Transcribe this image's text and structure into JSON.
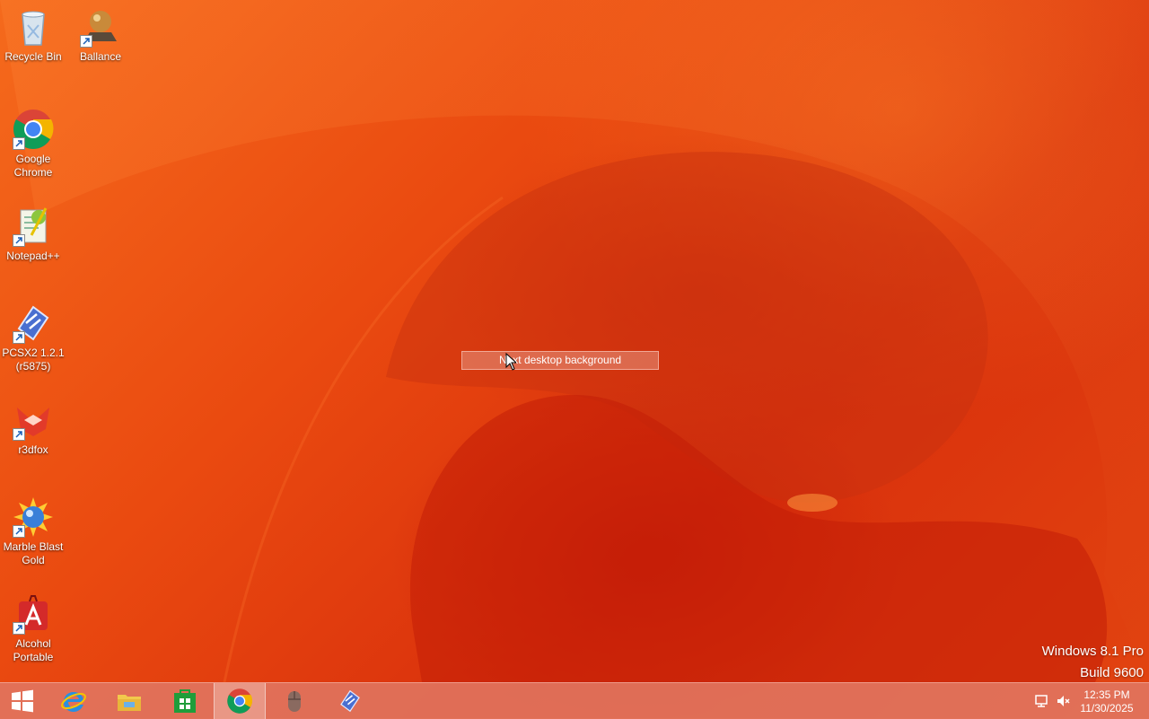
{
  "desktop_icons": [
    {
      "label": "Recycle Bin",
      "icon": "recycle-bin-icon",
      "shortcut": false
    },
    {
      "label": "Ballance",
      "icon": "ballance-icon",
      "shortcut": true
    },
    {
      "label": "Google Chrome",
      "icon": "chrome-icon",
      "shortcut": true
    },
    {
      "label": "Notepad++",
      "icon": "notepadpp-icon",
      "shortcut": true
    },
    {
      "label": "PCSX2 1.2.1 (r5875)",
      "icon": "pcsx2-icon",
      "shortcut": true
    },
    {
      "label": "r3dfox",
      "icon": "r3dfox-icon",
      "shortcut": true
    },
    {
      "label": "Marble Blast Gold",
      "icon": "marble-blast-icon",
      "shortcut": true
    },
    {
      "label": "Alcohol Portable",
      "icon": "alcohol-icon",
      "shortcut": true
    }
  ],
  "tooltip": {
    "text": "Next desktop background"
  },
  "watermark": {
    "line1": "Windows 8.1 Pro",
    "line2": "Build 9600"
  },
  "taskbar": {
    "items": [
      {
        "name": "start",
        "icon": "windows-logo-icon",
        "active": false
      },
      {
        "name": "internet-explorer",
        "icon": "internet-explorer-icon",
        "active": false
      },
      {
        "name": "file-explorer",
        "icon": "file-explorer-icon",
        "active": false
      },
      {
        "name": "store",
        "icon": "windows-store-icon",
        "active": false
      },
      {
        "name": "chrome",
        "icon": "chrome-icon",
        "active": true
      },
      {
        "name": "mouse",
        "icon": "mouse-icon",
        "active": false
      },
      {
        "name": "pcsx2",
        "icon": "pcsx2-icon",
        "active": false
      }
    ]
  },
  "tray": {
    "icons": [
      "network-icon",
      "speaker-muted-icon"
    ],
    "time": "12:35 PM",
    "date": "11/30/2025"
  },
  "colors": {
    "wallpaper": "#e84a10",
    "taskbar": "#e17864",
    "text": "#ffffff"
  }
}
